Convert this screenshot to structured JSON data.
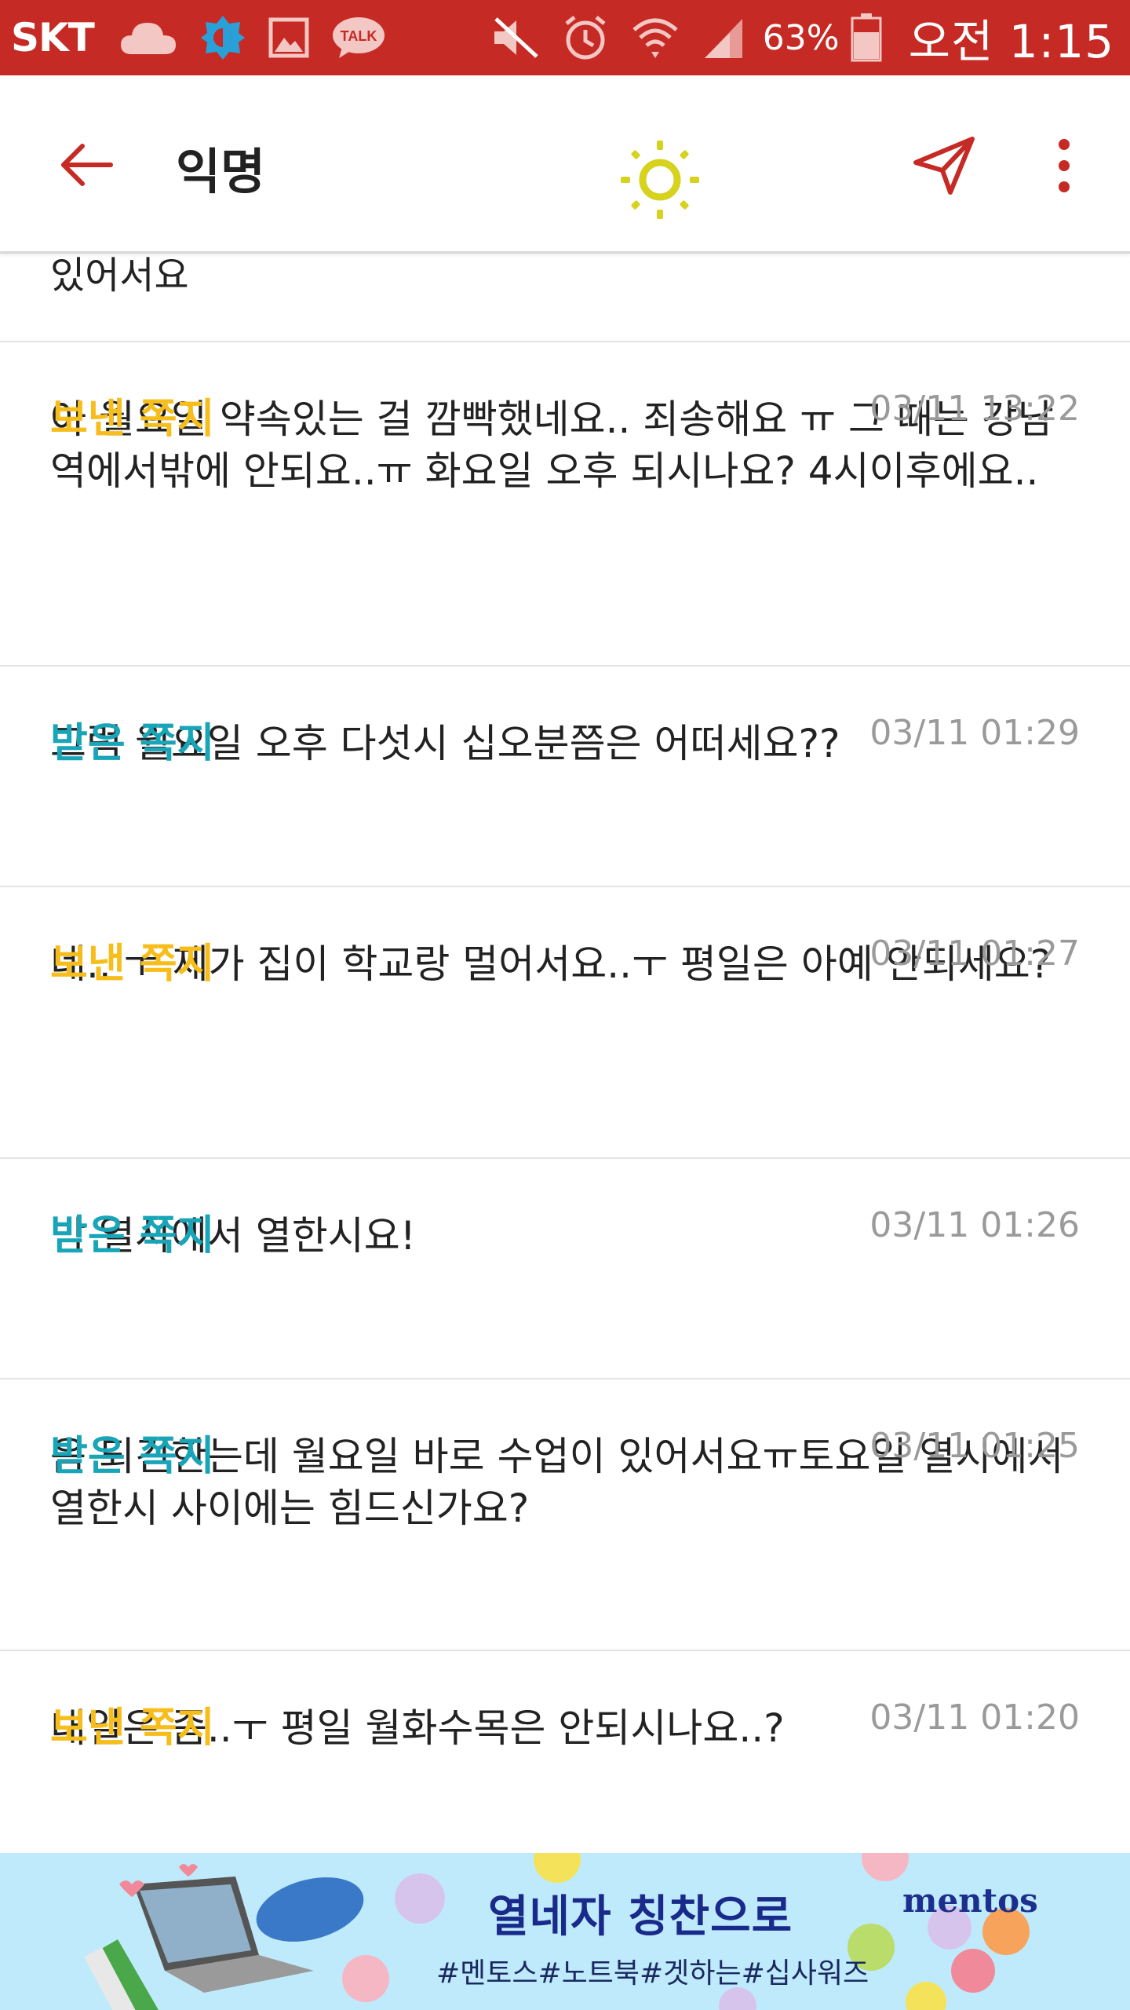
{
  "status_bar": {
    "carrier": "SKT",
    "left_icons": [
      "cloud-icon",
      "display-icon",
      "gallery-icon",
      "kakaotalk-icon"
    ],
    "kakao_label": "TALK",
    "right_icons": [
      "mute-icon",
      "alarm-icon",
      "wifi-icon",
      "signal-icon"
    ],
    "battery_percent": "63%",
    "time": "오전 1:15",
    "color": "#c62a24"
  },
  "app_bar": {
    "title": "익명",
    "icons": [
      "back-arrow-icon",
      "sun-icon",
      "send-icon",
      "more-vert-icon"
    ],
    "accent_color": "#c62a24",
    "sun_color": "#d6d21e"
  },
  "messages_partial_text": "있어서요",
  "messages": [
    {
      "type": "보낸 쪽지",
      "kind": "sent",
      "time": "03/11 13:22",
      "text": "아 월요일 약속있는 걸 깜빡했네요.. 죄송해요 ㅠ 그 때는 강남역에서밖에 안되요..ㅠ 화요일 오후 되시나요? 4시이후에요.."
    },
    {
      "type": "받은 쪽지",
      "kind": "received",
      "time": "03/11 01:29",
      "text": "그럼 월요일 오후 다섯시 십오분쯤은 어떠세요??"
    },
    {
      "type": "보낸 쪽지",
      "kind": "sent",
      "time": "03/11 01:27",
      "text": "네.. ㅜ 제가 집이 학교랑 멀어서요..ㅜ 평일은 아예 안되세요?"
    },
    {
      "type": "받은 쪽지",
      "kind": "received",
      "time": "03/11 01:26",
      "text": "밤 열시에서 열한시요!"
    },
    {
      "type": "받은 쪽지",
      "kind": "received",
      "time": "03/11 01:25",
      "text": "음 되긴한는데 월요일 바로 수업이 있어서요ㅠ토요일 열시에서 열한시 사이에는 힘드신가요?"
    },
    {
      "type": "보낸 쪽지",
      "kind": "sent",
      "time": "03/11 01:20",
      "text": "내일은 좀..ㅜ 평일 월화수목은 안되시나요..?"
    }
  ],
  "colors": {
    "sent_label": "#f7bd1b",
    "received_label": "#18a5b8",
    "timestamp": "#9a9a9a"
  },
  "ad": {
    "title": "열네자 칭찬으로",
    "subtitle": "#멘토스#노트북#겟하는#십사워즈",
    "brand": "mentos",
    "background": "#bfeafb"
  }
}
